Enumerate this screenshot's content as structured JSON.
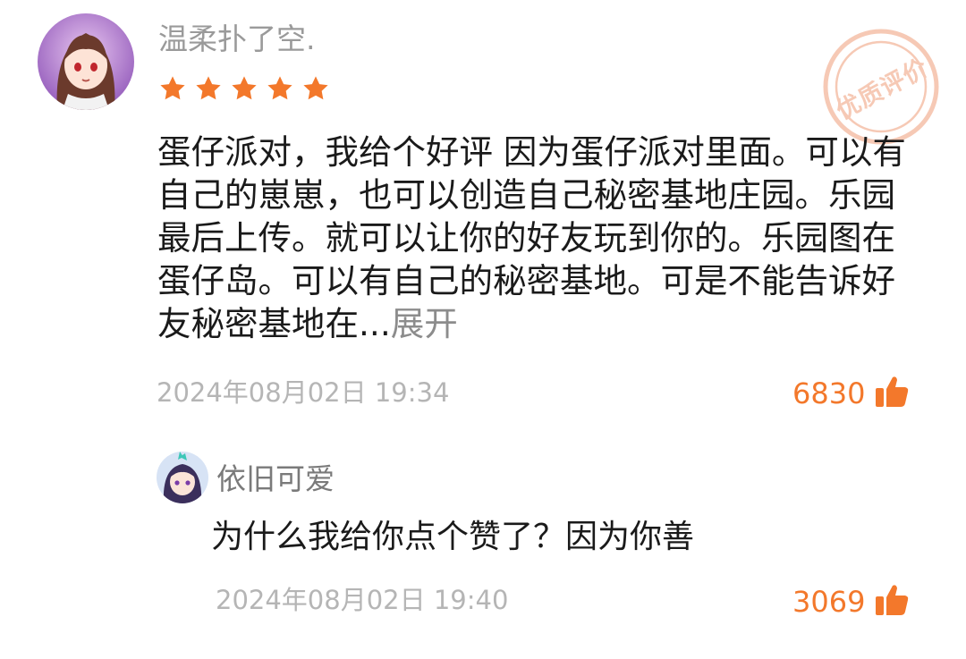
{
  "review": {
    "username": "温柔扑了空.",
    "rating": 5,
    "text": "蛋仔派对，我给个好评 因为蛋仔派对里面。可以有自己的崽崽，也可以创造自己秘密基地庄园。乐园最后上传。就可以让你的好友玩到你的。乐园图在蛋仔岛。可以有自己的秘密基地。可是不能告诉好友秘密基地在...",
    "expand_label": "展开",
    "timestamp": "2024年08月02日 19:34",
    "likes": "6830",
    "badge_label": "优质评价"
  },
  "reply": {
    "username": "依旧可爱",
    "text": "为什么我给你点个赞了？因为你善",
    "timestamp": "2024年08月02日 19:40",
    "likes": "3069"
  },
  "colors": {
    "accent": "#f3782b",
    "star": "#f3782b",
    "muted": "#9a9a9a",
    "timestamp": "#b5b5b5",
    "badge": "#f6c9b5"
  }
}
